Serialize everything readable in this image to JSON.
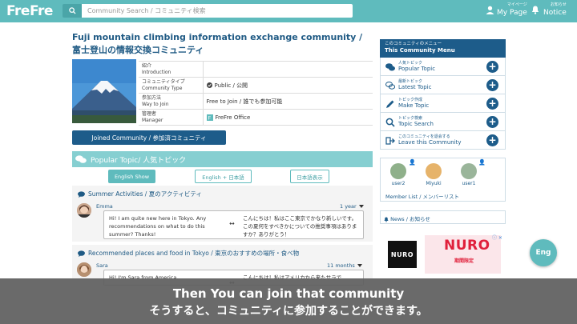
{
  "header": {
    "logo": "FreFre",
    "search_placeholder": "Community Search / コミュニティ検索",
    "mypage_small": "マイページ",
    "mypage_label": "My Page",
    "notice_small": "お知らせ",
    "notice_label": "Notice"
  },
  "community": {
    "title": "Fuji mountain climbing information exchange community / 富士登山の情報交換コミュニティ",
    "info": [
      {
        "label_ja": "紹介",
        "label_en": "Introduction",
        "value": ""
      },
      {
        "label_ja": "コミュニティタイプ",
        "label_en": "Community Type",
        "value": "Public / 公開"
      },
      {
        "label_ja": "参加方法",
        "label_en": "Way to Join",
        "value": "Free to Join / 誰でも参加可能"
      },
      {
        "label_ja": "管理者",
        "label_en": "Manager",
        "value": "FreFre Office"
      }
    ],
    "join_button": "Joined Community / 参加済コミュニティ"
  },
  "popular": {
    "heading": "Popular Topic/ 人気トピック",
    "lang_buttons": [
      "English Show",
      "English + 日本語",
      "日本語表示"
    ],
    "topics": [
      {
        "title": "Summer Activities / 夏のアクティビティ",
        "author": "Emma",
        "time": "1 year",
        "text_en": "Hi! I am quite new here in Tokyo. Any recommendations on what to do this summer? Thanks!",
        "text_ja": "こんにちは！私はここ東京でかなり新しいです。この夏何をすべきかについての推奨事項はありますか？ありがとう！"
      },
      {
        "title": "Recommended places and food in Tokyo / 東京のおすすめの場所・食べ物",
        "author": "Sara",
        "time": "11 months",
        "text_en": "Hi! I'm Sara from America.",
        "text_ja": "こんにちは！私はアメリカから来たサラで"
      }
    ]
  },
  "menu": {
    "head_small": "このコミュニティのメニュー",
    "head_big": "This Community Menu",
    "items": [
      {
        "small": "人気トピック",
        "big": "Popular Topic"
      },
      {
        "small": "最新トピック",
        "big": "Latest Topic"
      },
      {
        "small": "トピック作成",
        "big": "Make Topic"
      },
      {
        "small": "トピック検索",
        "big": "Topic Search"
      },
      {
        "small": "このコミュニティを退会する",
        "big": "Leave this Community"
      }
    ]
  },
  "members": {
    "users": [
      "user2",
      "Miyuki",
      "user1"
    ],
    "list_label": "Member List / メンバーリスト"
  },
  "news": {
    "label": "News / お知らせ"
  },
  "ad": {
    "brand_black": "NURO",
    "brand_red": "NURO",
    "tagline": "期間限定"
  },
  "eng_button": "Eng",
  "subtitle": {
    "line1": "Then You can join that community",
    "line2": "そうすると、コミュニティに参加することができます。"
  },
  "colors": {
    "teal": "#5fbbbd",
    "navy": "#1d5c8a"
  }
}
